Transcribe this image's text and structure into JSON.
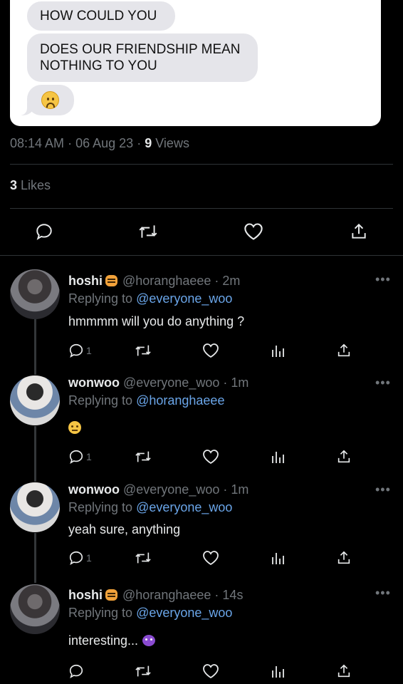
{
  "screenshot_card": {
    "messages": [
      "HOW COULD YOU",
      "DOES OUR FRIENDSHIP MEAN NOTHING TO YOU"
    ],
    "emoji": "frowning-face"
  },
  "tweet_meta": {
    "time": "08:14 AM",
    "date": "06 Aug 23",
    "views_count": "9",
    "views_label": "Views"
  },
  "likes": {
    "count": "3",
    "label": "Likes"
  },
  "replies": [
    {
      "name": "hoshi",
      "handle": "@horanghaeee",
      "time": "2m",
      "replying_prefix": "Replying to",
      "replying_to": "@everyone_woo",
      "text": "hmmmm will you do anything ?",
      "reply_count": "1"
    },
    {
      "name": "wonwoo",
      "handle": "@everyone_woo",
      "time": "1m",
      "replying_prefix": "Replying to",
      "replying_to": "@horanghaeee",
      "text": "",
      "reply_count": "1"
    },
    {
      "name": "wonwoo",
      "handle": "@everyone_woo",
      "time": "1m",
      "replying_prefix": "Replying to",
      "replying_to": "@everyone_woo",
      "text": "yeah sure, anything",
      "reply_count": "1"
    },
    {
      "name": "hoshi",
      "handle": "@horanghaeee",
      "time": "14s",
      "replying_prefix": "Replying to",
      "replying_to": "@everyone_woo",
      "text": "interesting...",
      "reply_count": ""
    }
  ],
  "separator": "·",
  "more_glyph": "•••",
  "colors": {
    "background": "#000000",
    "link": "#6aa5e8",
    "muted": "#71767b",
    "text": "#e7e9ea"
  }
}
